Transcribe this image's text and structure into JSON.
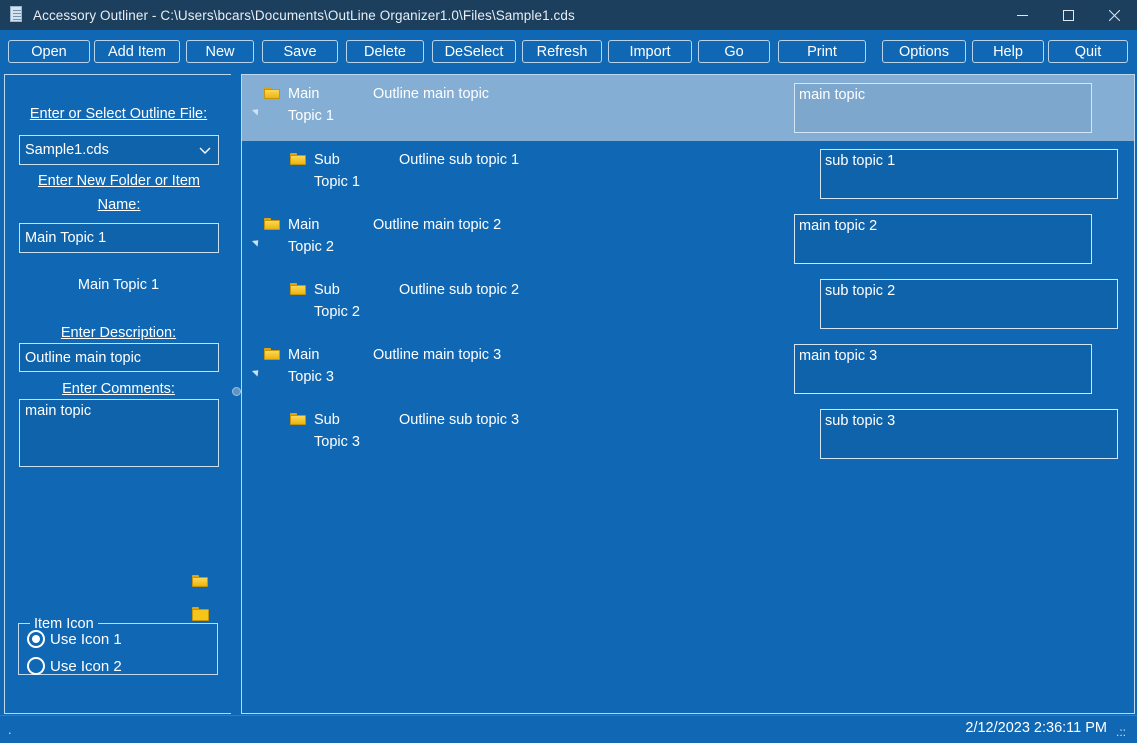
{
  "window": {
    "title": "Accessory Outliner - C:\\Users\\bcars\\Documents\\OutLine Organizer1.0\\Files\\Sample1.cds",
    "icon": "document-icon",
    "minimize_label": "—",
    "maximize_label": "☐",
    "close_label": "✕"
  },
  "toolbar": {
    "buttons": [
      {
        "label": "Open",
        "name": "open-button"
      },
      {
        "label": "Add Item",
        "name": "add-item-button"
      },
      {
        "label": "New",
        "name": "new-button"
      },
      {
        "label": "Save",
        "name": "save-button"
      },
      {
        "label": "Delete",
        "name": "delete-button"
      },
      {
        "label": "DeSelect",
        "name": "deselect-button"
      },
      {
        "label": "Refresh",
        "name": "refresh-button"
      },
      {
        "label": "Import",
        "name": "import-button"
      },
      {
        "label": "Go",
        "name": "go-button"
      },
      {
        "label": "Print",
        "name": "print-button"
      },
      {
        "label": "Options",
        "name": "options-button"
      },
      {
        "label": "Help",
        "name": "help-button"
      },
      {
        "label": "Quit",
        "name": "quit-button"
      }
    ]
  },
  "sidebar": {
    "outline_file_label": "Enter or Select Outline File:",
    "outline_file_value": "Sample1.cds",
    "new_item_label": "Enter New Folder or Item Name:",
    "new_item_value": "Main Topic 1",
    "selected_item_text": "Main Topic 1",
    "description_label": "Enter Description:",
    "description_value": "Outline main topic",
    "comments_label": "Enter Comments:",
    "comments_value": "main topic",
    "icon_preview_1": "folder-icon-1",
    "icon_preview_2": "folder-icon-2",
    "item_icon_group_label": "Item Icon",
    "radio_options": [
      {
        "label": "Use Icon 1",
        "selected": true
      },
      {
        "label": "Use Icon 2",
        "selected": false
      }
    ]
  },
  "tree": {
    "rows": [
      {
        "name": "Main Topic 1",
        "description": "Outline main topic",
        "comment": "main topic",
        "level": 0,
        "selected": true,
        "expanded": true,
        "icon": "folder-icon"
      },
      {
        "name": "Sub Topic 1",
        "description": "Outline sub topic 1",
        "comment": "sub topic 1",
        "level": 1,
        "selected": false,
        "expanded": false,
        "icon": "folder-icon"
      },
      {
        "name": "Main Topic 2",
        "description": "Outline main topic 2",
        "comment": "main topic 2",
        "level": 0,
        "selected": false,
        "expanded": true,
        "icon": "folder-icon"
      },
      {
        "name": "Sub Topic 2",
        "description": "Outline sub topic 2",
        "comment": "sub topic 2",
        "level": 1,
        "selected": false,
        "expanded": false,
        "icon": "folder-icon"
      },
      {
        "name": "Main Topic 3",
        "description": "Outline main topic 3",
        "comment": "main topic 3",
        "level": 0,
        "selected": false,
        "expanded": true,
        "icon": "folder-icon"
      },
      {
        "name": "Sub Topic 3",
        "description": "Outline sub topic 3",
        "comment": "sub topic 3",
        "level": 1,
        "selected": false,
        "expanded": false,
        "icon": "folder-icon"
      }
    ]
  },
  "statusbar": {
    "left_text": ".",
    "timestamp": "2/12/2023 2:36:11 PM",
    "grip": ".::"
  },
  "colors": {
    "window_background": "#1068b4",
    "titlebar": "#1c3f5e",
    "field_background": "#0f63ab",
    "selection": "#84aed4",
    "border": "#bcd8ef",
    "text": "#ffffff",
    "folder_icon": "#f5c518"
  }
}
